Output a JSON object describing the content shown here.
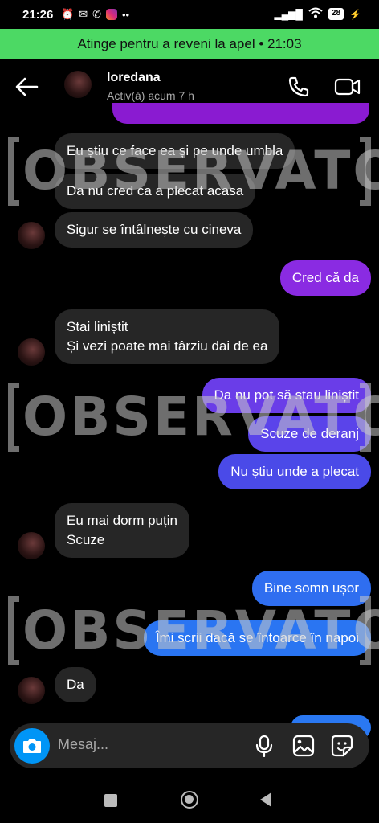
{
  "status_bar": {
    "time": "21:26",
    "battery": "28"
  },
  "call_banner": {
    "text": "Atinge pentru a reveni la apel • 21:03"
  },
  "header": {
    "name": "loredana",
    "status": "Activ(ă) acum 7 h"
  },
  "messages": [
    {
      "from": "them",
      "text": "Eu știu ce face ea și pe unde umbla"
    },
    {
      "from": "them",
      "text": "Da nu cred ca a plecat acasa"
    },
    {
      "from": "them",
      "text": "Sigur se întâlnește cu cineva"
    },
    {
      "from": "me",
      "text": "Cred că da",
      "color": "#8a2be2"
    },
    {
      "from": "them",
      "line1": "Stai liniștit",
      "line2": "Și vezi poate mai târziu dai de ea"
    },
    {
      "from": "me",
      "text": "Da nu pot să stau liniștit",
      "color": "#6a3de8"
    },
    {
      "from": "me",
      "text": "Scuze de deranj",
      "color": "#5a44ea"
    },
    {
      "from": "me",
      "text": "Nu știu unde a plecat",
      "color": "#4a4ae8"
    },
    {
      "from": "them",
      "line1": "Eu mai dorm puțin",
      "line2": "Scuze"
    },
    {
      "from": "me",
      "text": "Bine somn ușor",
      "color": "#2f6ef0"
    },
    {
      "from": "me",
      "text": "Îmi scrii dacă se întoarce în napoi",
      "color": "#2a75f2"
    },
    {
      "from": "them",
      "text": "Da"
    }
  ],
  "watermark": {
    "text": "OBSERVATOR"
  },
  "composer": {
    "placeholder": "Mesaj..."
  },
  "colors": {
    "call_banner": "#4cd964",
    "incoming_bubble": "#262626",
    "camera_button": "#0095f6"
  }
}
